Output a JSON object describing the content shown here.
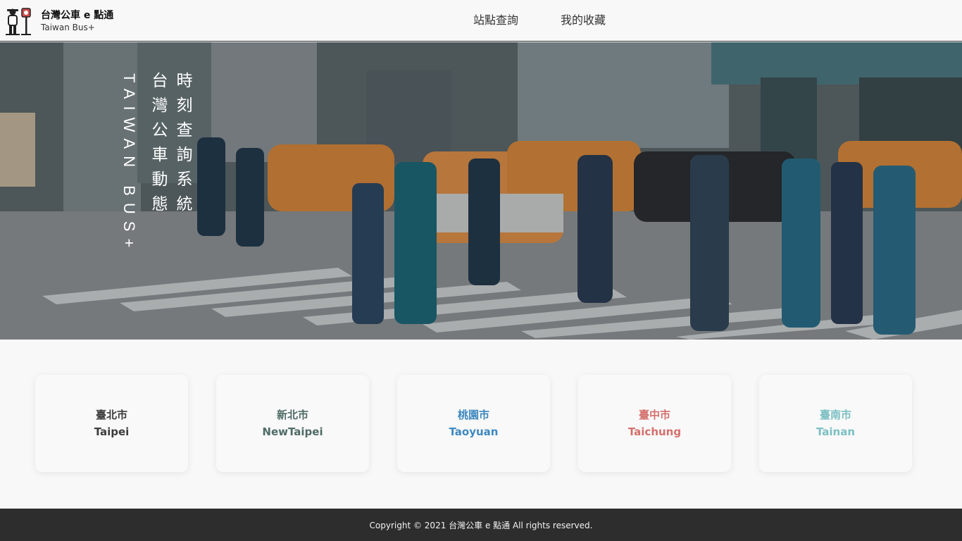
{
  "header": {
    "logo_title": "台灣公車 e 點通",
    "logo_subtitle": "Taiwan Bus+",
    "logo_icon": "bus-stop-person-icon",
    "nav": [
      {
        "label": "站點查詢"
      },
      {
        "label": "我的收藏"
      }
    ]
  },
  "hero": {
    "vertical_en": "TAIWAN BUS+",
    "vertical_zh_left": "台灣公車動態",
    "vertical_zh_right": "時刻查詢系統"
  },
  "cities": [
    {
      "zh": "臺北市",
      "en": "Taipei",
      "color": "#3d3d3d"
    },
    {
      "zh": "新北市",
      "en": "NewTaipei",
      "color": "#4f6b66"
    },
    {
      "zh": "桃園市",
      "en": "Taoyuan",
      "color": "#3f88c0"
    },
    {
      "zh": "臺中市",
      "en": "Taichung",
      "color": "#d4706d"
    },
    {
      "zh": "臺南市",
      "en": "Tainan",
      "color": "#7cc0c4"
    }
  ],
  "footer": {
    "text": "Copyright © 2021 台灣公車 e 點通 All rights reserved."
  }
}
